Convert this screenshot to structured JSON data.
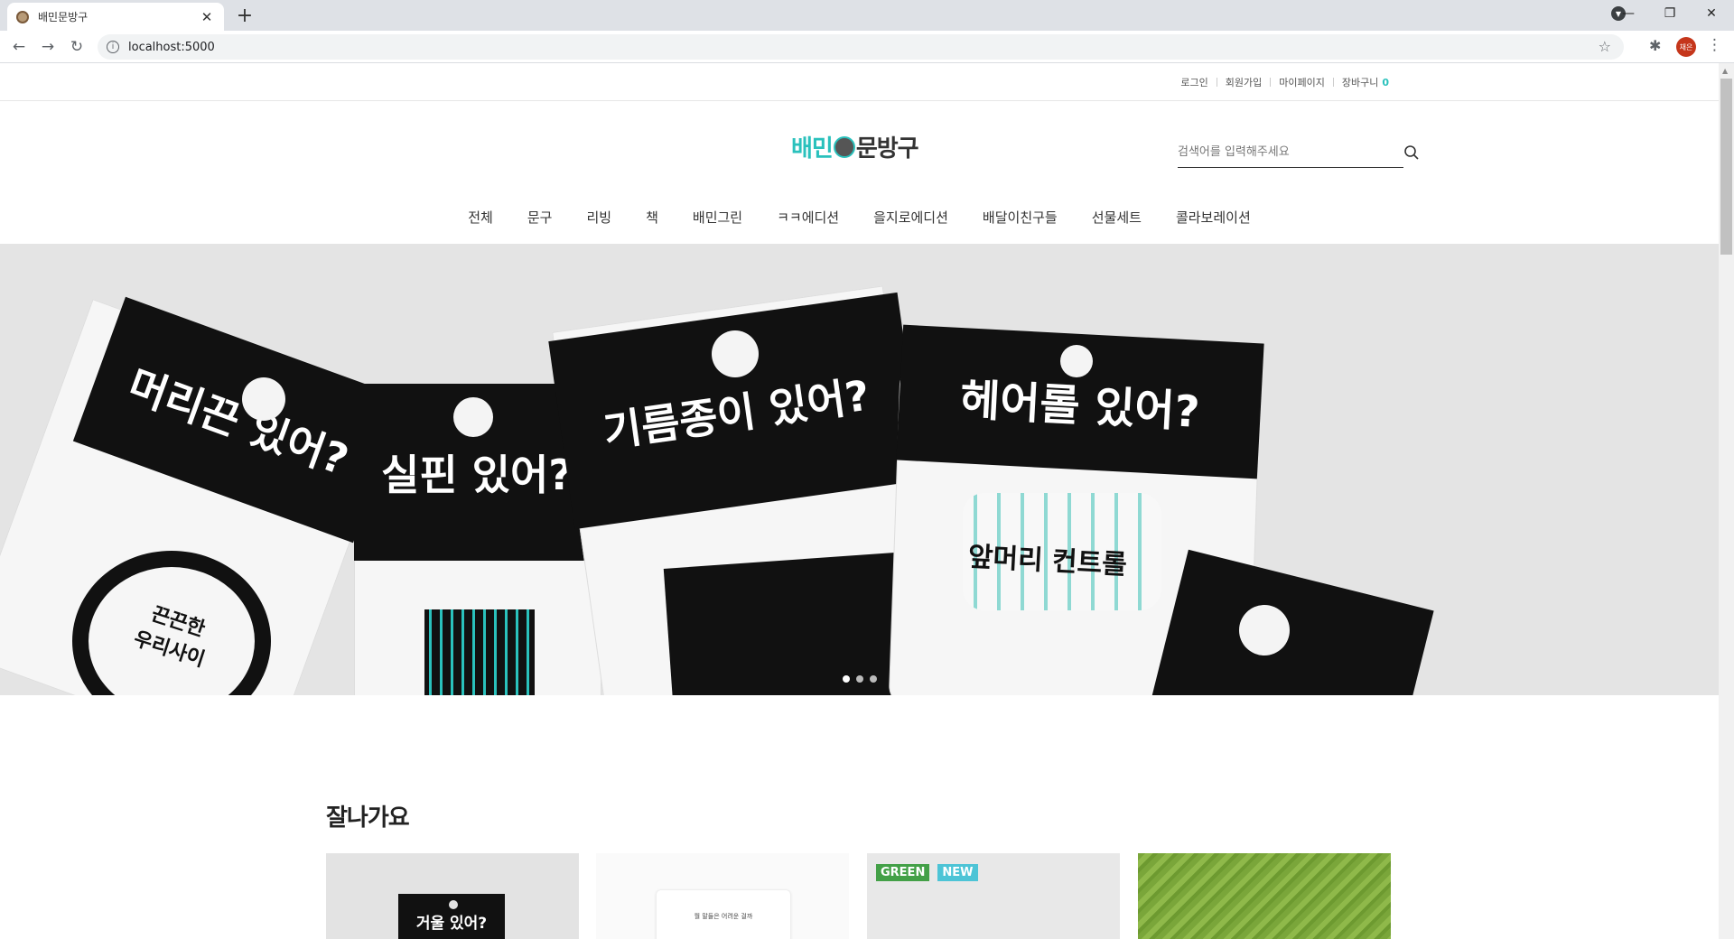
{
  "browser": {
    "tab_title": "배민문방구",
    "tab_close": "✕",
    "new_tab": "+",
    "url": "localhost:5000",
    "profile_initial": "채은",
    "controls": {
      "minimize": "—",
      "restore": "❐",
      "close": "✕"
    }
  },
  "header": {
    "util_links": [
      "로그인",
      "회원가입",
      "마이페이지",
      "장바구니"
    ],
    "cart_count": "0",
    "logo": {
      "part1": "배민",
      "part2": "문방구"
    },
    "search": {
      "placeholder": "검색어를 입력해주세요",
      "value": ""
    },
    "nav": [
      "전체",
      "문구",
      "리빙",
      "책",
      "배민그린",
      "ㅋㅋ에디션",
      "을지로에디션",
      "배달이친구들",
      "선물세트",
      "콜라보레이션"
    ]
  },
  "hero": {
    "cards": [
      "머리끈 있어?",
      "실핀 있어?",
      "기름종이 있어?",
      "헤어롤 있어?"
    ],
    "stickers": [
      "끈끈한\n우리사이",
      "앞머리 컨트롤"
    ],
    "slides": 3,
    "active_slide": 0
  },
  "section": {
    "title": "잘나가요",
    "products": [
      {
        "caption": "거울 있어?"
      },
      {
        "caption": "월 말들은 어려운 걸까"
      },
      {
        "badges": [
          "GREEN",
          "NEW"
        ]
      },
      {}
    ]
  },
  "colors": {
    "accent": "#2ac1bc",
    "green_badge": "#43a047",
    "new_badge": "#4dc4d6"
  }
}
